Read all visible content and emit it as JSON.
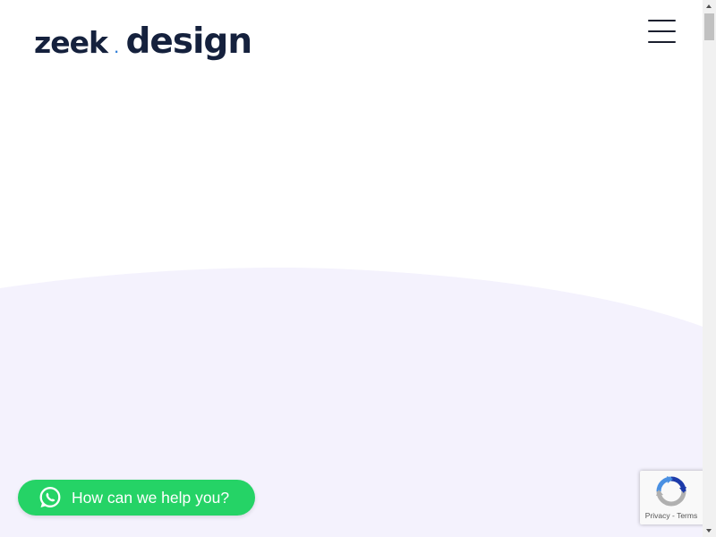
{
  "header": {
    "logo": {
      "word1": "zeek",
      "separator": ".",
      "word2": "design"
    },
    "menu_icon": "hamburger-menu-icon"
  },
  "colors": {
    "logo_text": "#15213d",
    "logo_dot": "#2e7dd8",
    "wave_fill": "#f4f2fd",
    "whatsapp_green": "#25d366",
    "recaptcha_blue": "#1c3aa9",
    "recaptcha_light_blue": "#4a90e2",
    "recaptcha_gray": "#b0b0b0"
  },
  "help_button": {
    "icon": "whatsapp-icon",
    "label": "How can we help you?"
  },
  "recaptcha": {
    "icon": "recaptcha-icon",
    "terms_text": "Privacy - Terms"
  }
}
